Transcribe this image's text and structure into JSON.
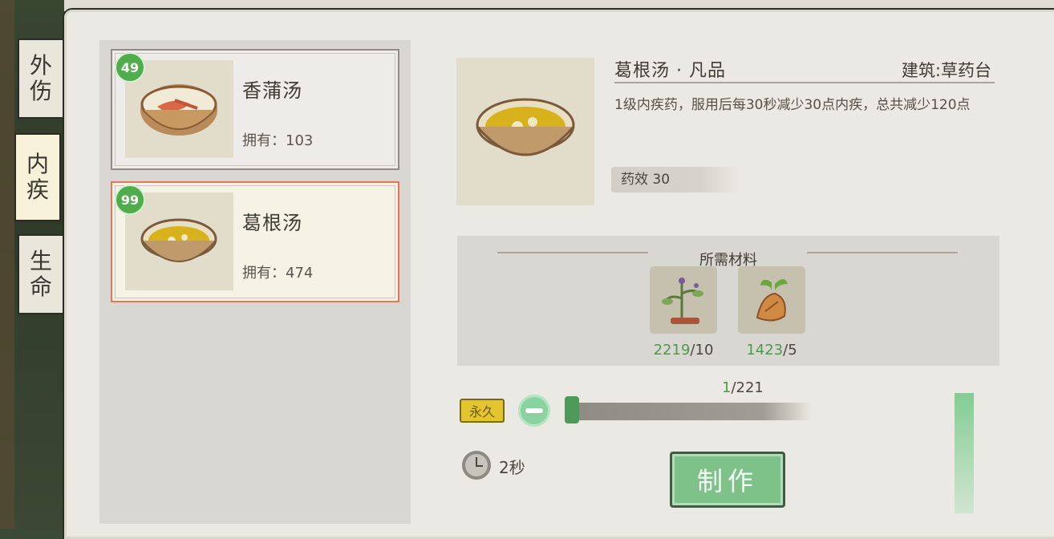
{
  "tabs": [
    {
      "label_line1": "外",
      "label_line2": "伤",
      "active": false
    },
    {
      "label_line1": "内",
      "label_line2": "疾",
      "active": true
    },
    {
      "label_line1": "生",
      "label_line2": "命",
      "active": false
    }
  ],
  "recipes": [
    {
      "badge": "49",
      "name": "香蒲汤",
      "owned": "拥有：103",
      "selected": false
    },
    {
      "badge": "99",
      "name": "葛根汤",
      "owned": "拥有：474",
      "selected": true
    }
  ],
  "detail": {
    "title": "葛根汤 · 凡品",
    "building": "建筑:草药台",
    "description": "1级内疾药，服用后每30秒减少30点内疾，总共减少120点",
    "effect": "药效 30"
  },
  "materials": {
    "title": "所需材料",
    "items": [
      {
        "icon": "herb-plant-icon",
        "have": "2219",
        "need": "/10"
      },
      {
        "icon": "root-tuber-icon",
        "have": "1423",
        "need": "/5"
      }
    ]
  },
  "quantity": {
    "current": "1",
    "max": "/221"
  },
  "permanent_label": "永久",
  "craft_time": "2秒",
  "craft_button": "制作",
  "colors": {
    "accent_green": "#4f9a4a",
    "badge_green": "#4fae4b",
    "select_border": "#e2775c",
    "button_green": "#7ec28a"
  }
}
